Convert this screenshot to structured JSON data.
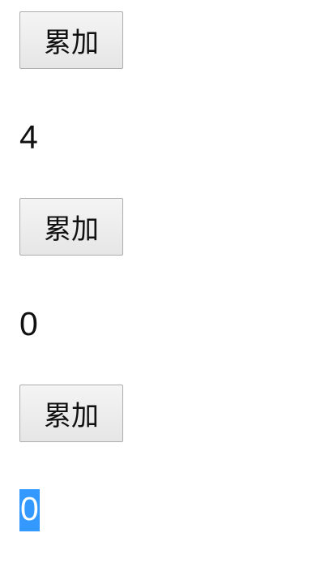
{
  "counters": [
    {
      "button_label": "累加",
      "value": "4"
    },
    {
      "button_label": "累加",
      "value": "0"
    },
    {
      "button_label": "累加",
      "value": "0"
    }
  ]
}
